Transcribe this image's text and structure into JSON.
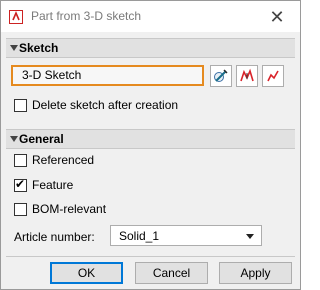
{
  "window": {
    "title": "Part from 3-D sketch",
    "close_symbol": "✕"
  },
  "sketch_section": {
    "header": "Sketch",
    "field_value": "3-D Sketch",
    "tools": [
      {
        "icon": "edit-sketch-icon"
      },
      {
        "icon": "sketch-select-icon"
      },
      {
        "icon": "sketch-pick-icon"
      }
    ],
    "delete_after_creation": {
      "label": "Delete sketch after creation",
      "checked": false
    }
  },
  "general_section": {
    "header": "General",
    "referenced": {
      "label": "Referenced",
      "checked": false
    },
    "feature": {
      "label": "Feature",
      "checked": true
    },
    "bom_relevant": {
      "label": "BOM-relevant",
      "checked": false
    },
    "article_number": {
      "label": "Article number:",
      "value": "Solid_1"
    }
  },
  "buttons": {
    "ok": "OK",
    "cancel": "Cancel",
    "apply": "Apply"
  },
  "colors": {
    "accent_border": "#e58a1f",
    "default_button_border": "#0078d7",
    "icon_red": "#d9232a"
  }
}
